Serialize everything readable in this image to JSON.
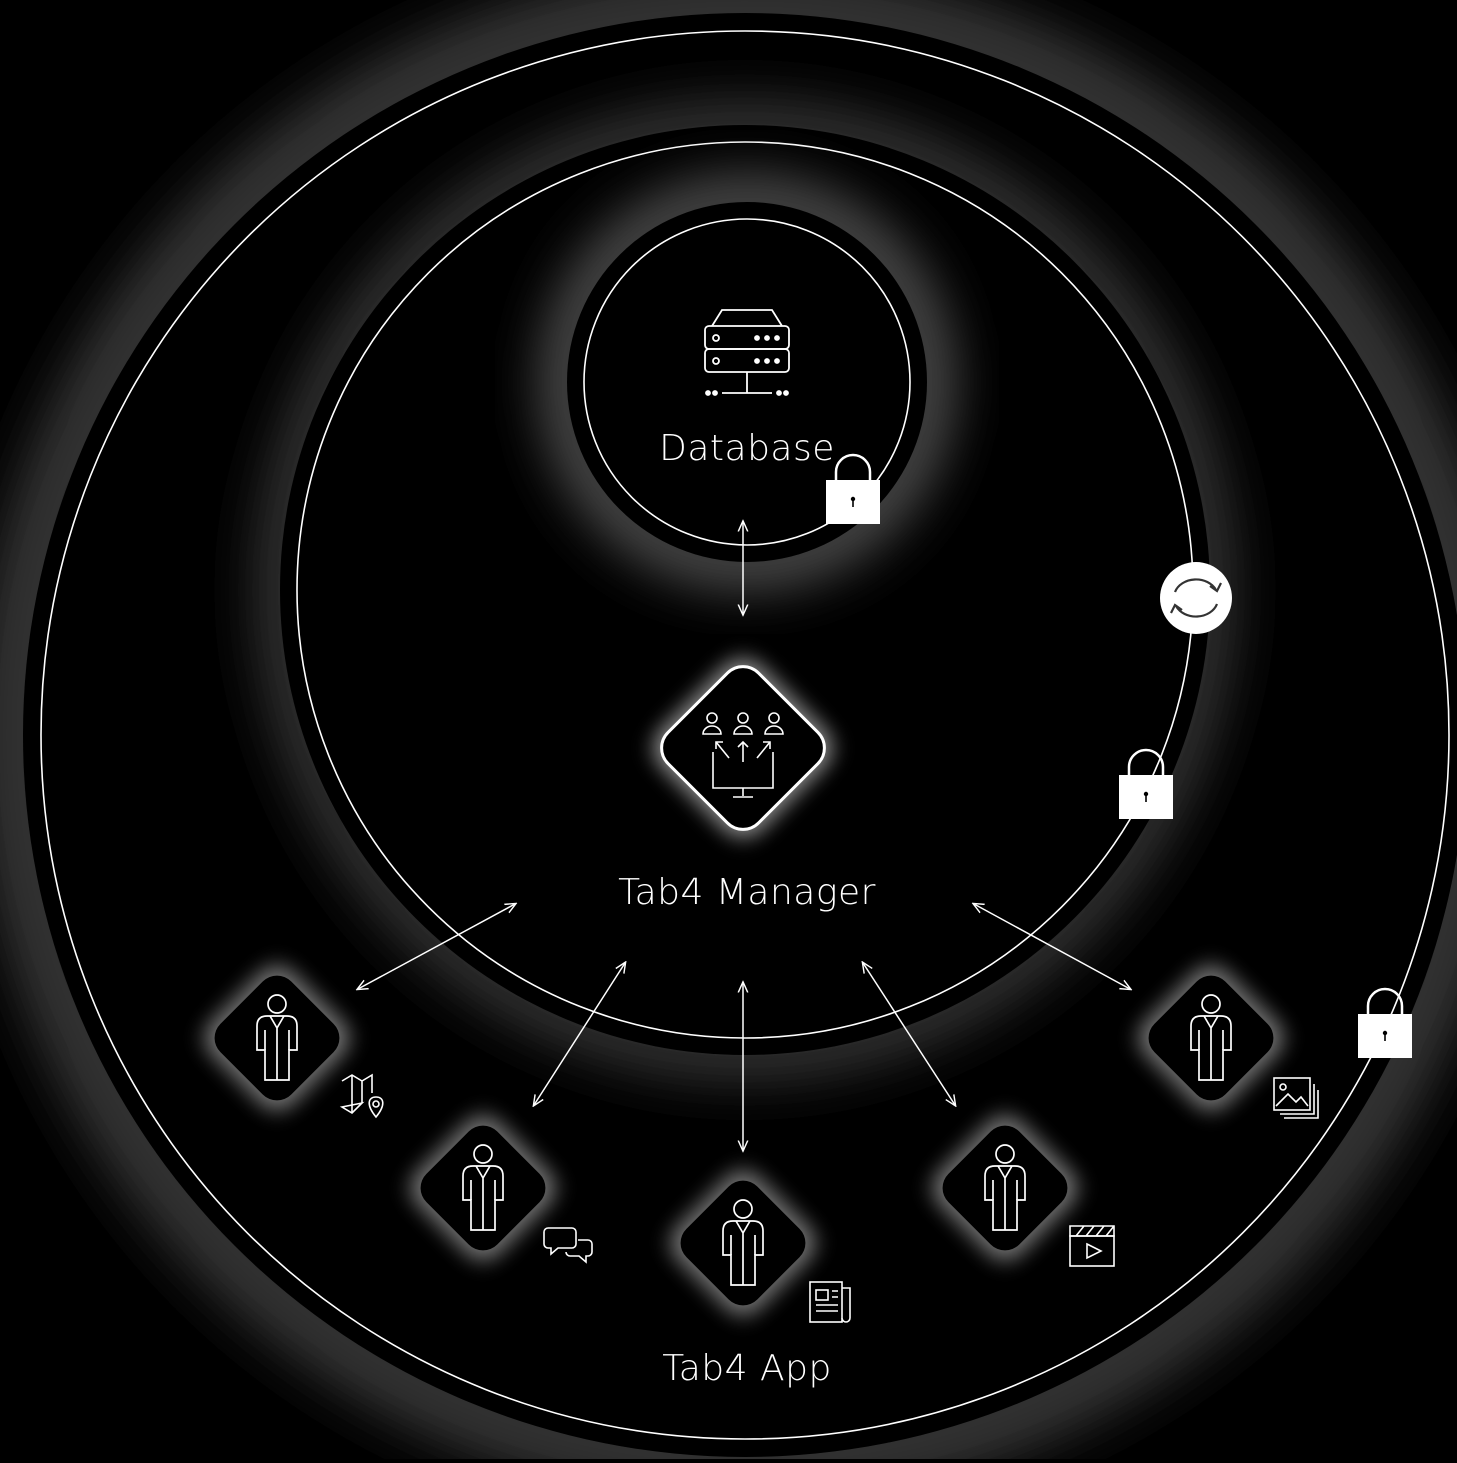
{
  "labels": {
    "database": "Database",
    "manager": "Tab4 Manager",
    "app": "Tab4 App"
  },
  "colors": {
    "background": "#000000",
    "stroke": "#ffffff",
    "glow": "#ffffff"
  },
  "icons": {
    "database": "server-database-icon",
    "manager": "users-distribution-monitor-icon",
    "sync": "sync-icon",
    "lock": "padlock-icon",
    "user": "user-person-icon",
    "map": "map-location-icon",
    "chat": "chat-bubbles-icon",
    "news": "newspaper-icon",
    "video": "video-player-icon",
    "gallery": "image-gallery-icon"
  },
  "app_users": [
    {
      "id": "user-1",
      "content": "map"
    },
    {
      "id": "user-2",
      "content": "chat"
    },
    {
      "id": "user-3",
      "content": "news"
    },
    {
      "id": "user-4",
      "content": "video"
    },
    {
      "id": "user-5",
      "content": "gallery"
    }
  ]
}
